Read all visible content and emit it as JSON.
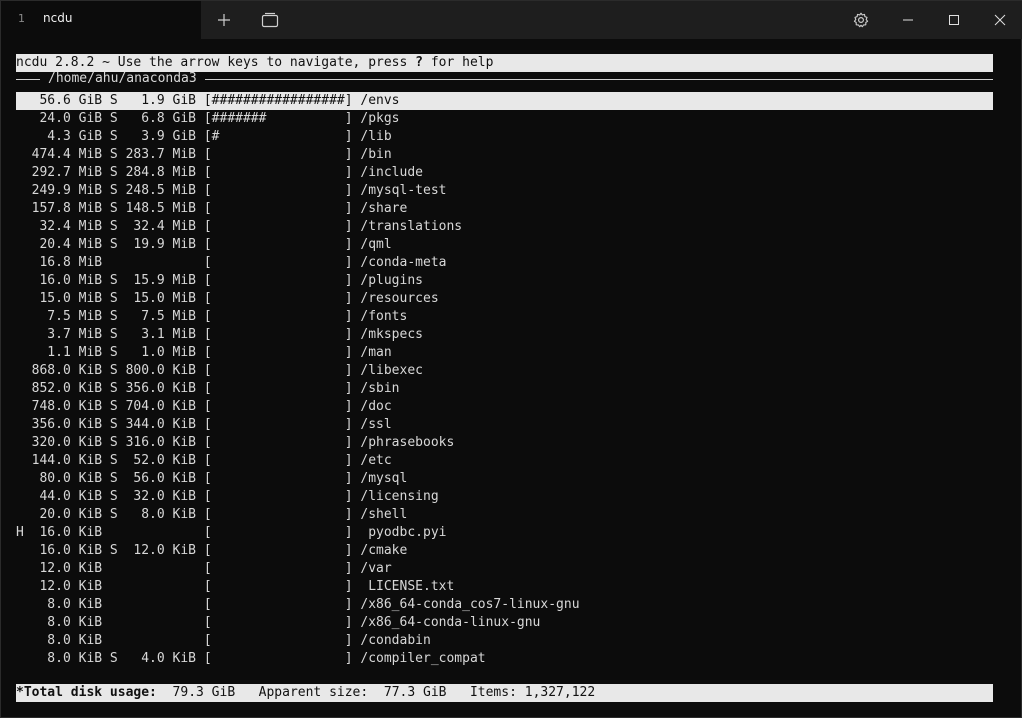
{
  "window": {
    "tab_index": "1",
    "tab_title": "ncdu"
  },
  "header": {
    "title_line": "ncdu 2.8.2 ~ Use the arrow keys to navigate, press ",
    "help_key": "?",
    "help_suffix": " for help"
  },
  "path": "/home/ahu/anaconda3",
  "rows": [
    {
      "text": "   56.6 GiB S   1.9 GiB [#################] /envs",
      "selected": true
    },
    {
      "text": "   24.0 GiB S   6.8 GiB [#######          ] /pkgs"
    },
    {
      "text": "    4.3 GiB S   3.9 GiB [#                ] /lib"
    },
    {
      "text": "  474.4 MiB S 283.7 MiB [                 ] /bin"
    },
    {
      "text": "  292.7 MiB S 284.8 MiB [                 ] /include"
    },
    {
      "text": "  249.9 MiB S 248.5 MiB [                 ] /mysql-test"
    },
    {
      "text": "  157.8 MiB S 148.5 MiB [                 ] /share"
    },
    {
      "text": "   32.4 MiB S  32.4 MiB [                 ] /translations"
    },
    {
      "text": "   20.4 MiB S  19.9 MiB [                 ] /qml"
    },
    {
      "text": "   16.8 MiB             [                 ] /conda-meta"
    },
    {
      "text": "   16.0 MiB S  15.9 MiB [                 ] /plugins"
    },
    {
      "text": "   15.0 MiB S  15.0 MiB [                 ] /resources"
    },
    {
      "text": "    7.5 MiB S   7.5 MiB [                 ] /fonts"
    },
    {
      "text": "    3.7 MiB S   3.1 MiB [                 ] /mkspecs"
    },
    {
      "text": "    1.1 MiB S   1.0 MiB [                 ] /man"
    },
    {
      "text": "  868.0 KiB S 800.0 KiB [                 ] /libexec"
    },
    {
      "text": "  852.0 KiB S 356.0 KiB [                 ] /sbin"
    },
    {
      "text": "  748.0 KiB S 704.0 KiB [                 ] /doc"
    },
    {
      "text": "  356.0 KiB S 344.0 KiB [                 ] /ssl"
    },
    {
      "text": "  320.0 KiB S 316.0 KiB [                 ] /phrasebooks"
    },
    {
      "text": "  144.0 KiB S  52.0 KiB [                 ] /etc"
    },
    {
      "text": "   80.0 KiB S  56.0 KiB [                 ] /mysql"
    },
    {
      "text": "   44.0 KiB S  32.0 KiB [                 ] /licensing"
    },
    {
      "text": "   20.0 KiB S   8.0 KiB [                 ] /shell"
    },
    {
      "text": "H  16.0 KiB             [                 ]  pyodbc.pyi"
    },
    {
      "text": "   16.0 KiB S  12.0 KiB [                 ] /cmake"
    },
    {
      "text": "   12.0 KiB             [                 ] /var"
    },
    {
      "text": "   12.0 KiB             [                 ]  LICENSE.txt"
    },
    {
      "text": "    8.0 KiB             [                 ] /x86_64-conda_cos7-linux-gnu"
    },
    {
      "text": "    8.0 KiB             [                 ] /x86_64-conda-linux-gnu"
    },
    {
      "text": "    8.0 KiB             [                 ] /condabin"
    },
    {
      "text": "    8.0 KiB S   4.0 KiB [                 ] /compiler_compat"
    }
  ],
  "footer": {
    "total_label": "*Total disk usage:",
    "total_value": "  79.3 GiB   Apparent size:  77.3 GiB   Items: 1,327,122"
  },
  "icons": {
    "new_tab": "plus-icon",
    "duplicate_tab": "tabs-icon",
    "settings": "gear-icon",
    "minimize": "minimize-icon",
    "maximize": "maximize-icon",
    "close": "close-icon"
  }
}
